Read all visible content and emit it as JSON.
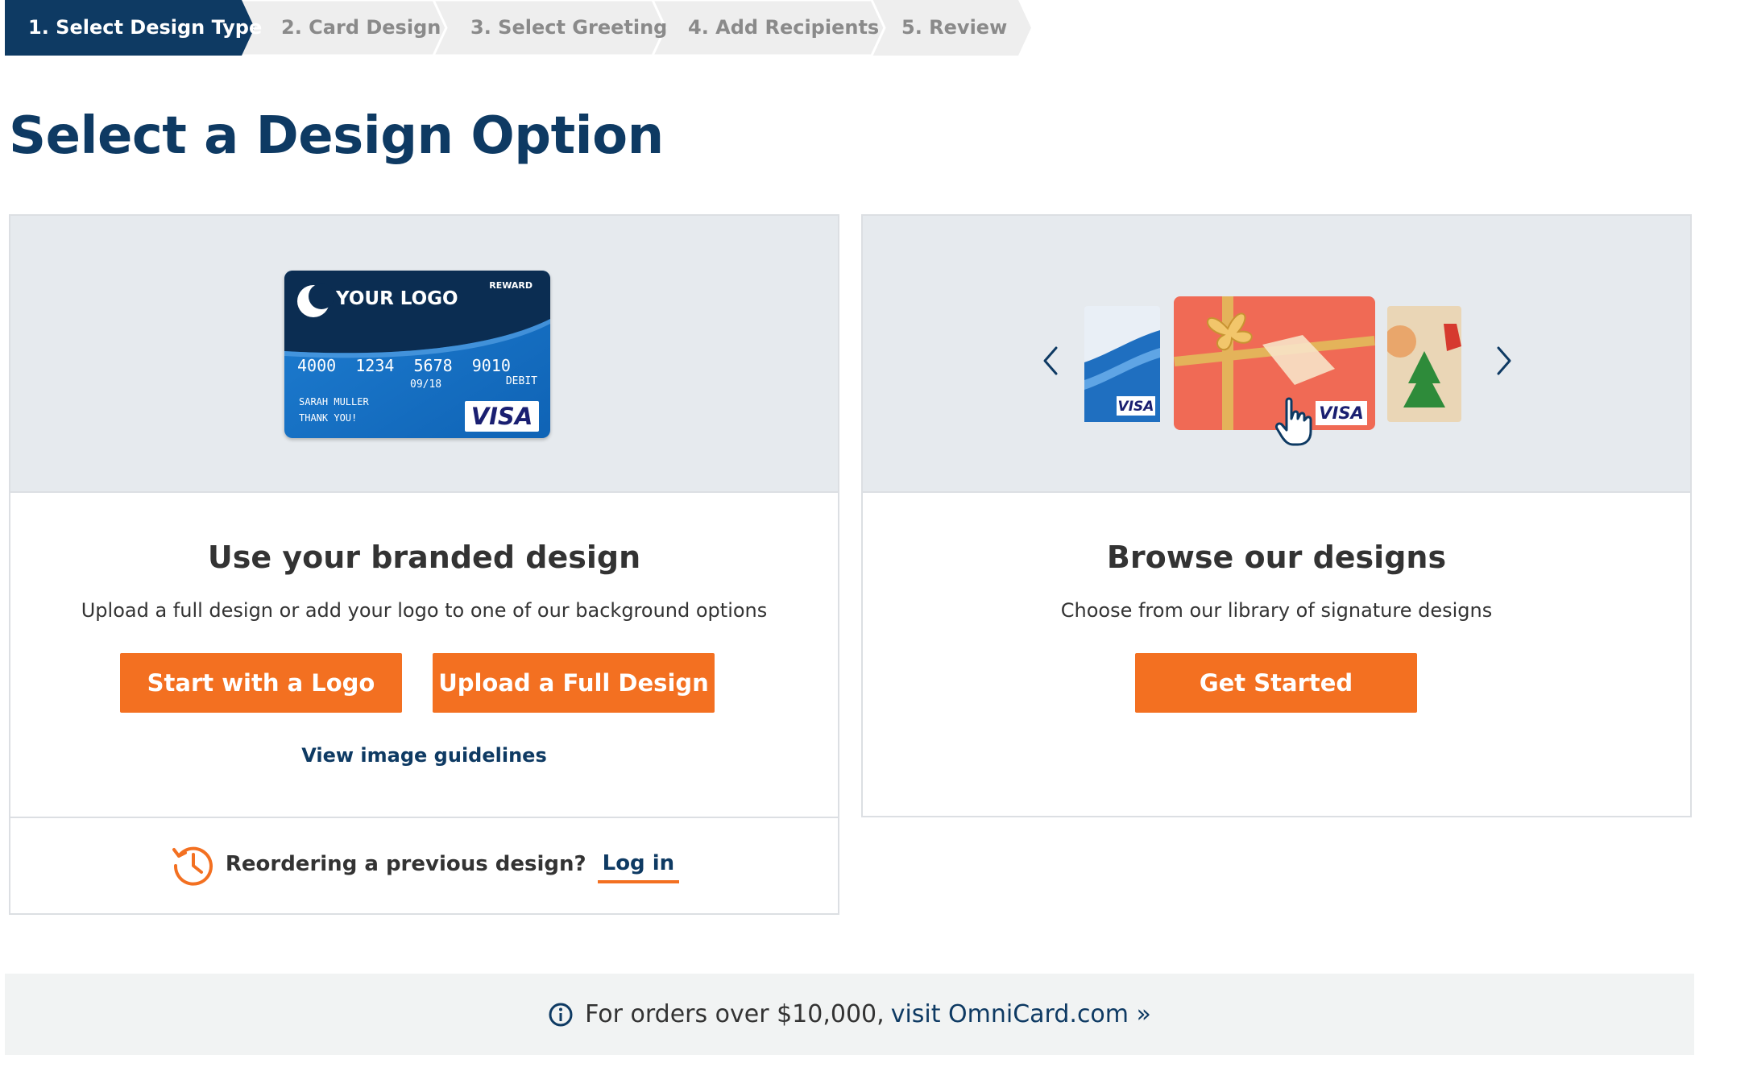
{
  "stepper": {
    "steps": [
      {
        "label": "1. Select Design Type",
        "active": true
      },
      {
        "label": "2. Card Design",
        "active": false
      },
      {
        "label": "3. Select Greeting",
        "active": false
      },
      {
        "label": "4. Add Recipients",
        "active": false
      },
      {
        "label": "5. Review",
        "active": false
      }
    ],
    "active_color": "#0e3a63",
    "inactive_color": "#eeeeee"
  },
  "page": {
    "title": "Select a Design Option"
  },
  "branded": {
    "title": "Use your branded design",
    "description": "Upload a full design or add your logo to one of our background options",
    "start_logo_label": "Start with a Logo",
    "upload_label": "Upload a Full Design",
    "guidelines_link": "View image guidelines",
    "card": {
      "logo_text": "YOUR LOGO",
      "reward": "REWARD",
      "number": "4000  1234  5678  9010",
      "expiry": "09/18",
      "debit": "DEBIT",
      "name_line1": "SARAH MULLER",
      "name_line2": "THANK YOU!",
      "brand": "VISA"
    },
    "reorder_text": "Reordering a previous design?",
    "login_link": "Log in"
  },
  "browse": {
    "title": "Browse our designs",
    "description": "Choose from our library of signature designs",
    "button_label": "Get Started"
  },
  "footer": {
    "text": "For orders over $10,000,",
    "link": "visit OmniCard.com »"
  },
  "colors": {
    "accent": "#f37021",
    "navy": "#0e3a63",
    "hero_bg": "#e6eaee"
  }
}
